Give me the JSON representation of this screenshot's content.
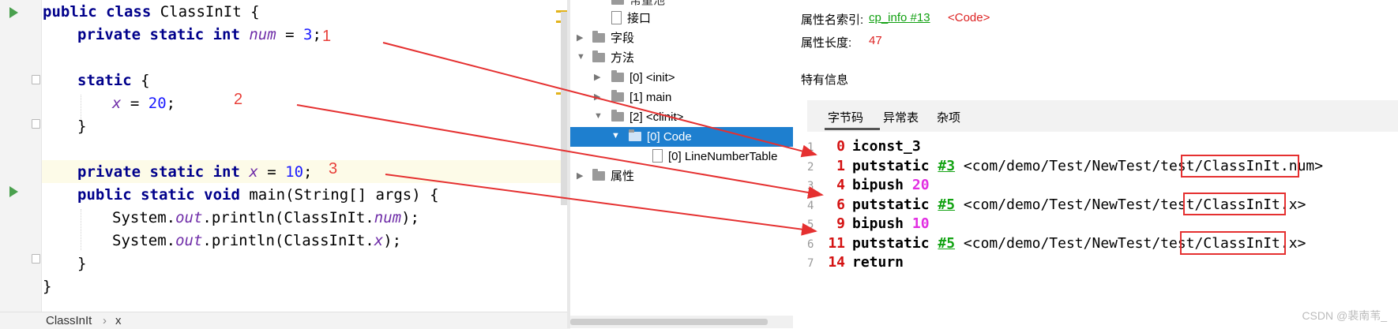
{
  "editor": {
    "lines": [
      {
        "kind": "class",
        "t1": "public class ",
        "t2": "ClassInIt {"
      },
      {
        "kind": "field",
        "k": "private static int ",
        "f": "num",
        "eq": " = ",
        "n": "3",
        "end": ";"
      },
      {
        "kind": "blank"
      },
      {
        "kind": "static",
        "k": "static",
        "rest": " {"
      },
      {
        "kind": "assign",
        "f": "x",
        "eq": " = ",
        "n": "20",
        "end": ";"
      },
      {
        "kind": "close",
        "t": "}"
      },
      {
        "kind": "blank"
      },
      {
        "kind": "field2",
        "k": "private static int ",
        "f": "x",
        "eq": " = ",
        "n": "10",
        "end": ";"
      },
      {
        "kind": "main",
        "k": "public static void ",
        "rest": "main(String[] args) {"
      },
      {
        "kind": "print",
        "a": "System.",
        "f": "out",
        "b": ".println(ClassInIt.",
        "f2": "num",
        "c": ");"
      },
      {
        "kind": "print",
        "a": "System.",
        "f": "out",
        "b": ".println(ClassInIt.",
        "f2": "x",
        "c": ");"
      },
      {
        "kind": "close",
        "t": "}"
      },
      {
        "kind": "close",
        "t": "}"
      }
    ],
    "annotations": [
      "1",
      "2",
      "3"
    ],
    "breadcrumb": {
      "class": "ClassInIt",
      "sep": "›",
      "member": "x"
    }
  },
  "tree": {
    "cut_item": "常量池",
    "items": [
      {
        "label": "接口"
      },
      {
        "label": "字段"
      },
      {
        "label": "方法"
      },
      {
        "label": "[0] <init>"
      },
      {
        "label": "[1] main"
      },
      {
        "label": "[2] <clinit>"
      },
      {
        "label": "[0] Code"
      },
      {
        "label": "[0] LineNumberTable"
      },
      {
        "label": "属性"
      }
    ]
  },
  "details": {
    "name_index_label": "属性名索引:",
    "name_index_link": "cp_info #13",
    "name_index_value": "<Code>",
    "length_label": "属性长度:",
    "length_value": "47",
    "specific_label": "特有信息",
    "tabs": [
      "字节码",
      "异常表",
      "杂项"
    ],
    "bytecode": [
      {
        "line": "1",
        "off": "0",
        "op": "iconst_3"
      },
      {
        "line": "2",
        "off": "1",
        "op": "putstatic",
        "ref": "#3",
        "desc_a": "<com/demo/Test/NewTest/test/",
        "desc_b": "ClassInIt.num>"
      },
      {
        "line": "3",
        "off": "4",
        "op": "bipush",
        "val": "20"
      },
      {
        "line": "4",
        "off": "6",
        "op": "putstatic",
        "ref": "#5",
        "desc_a": "<com/demo/Test/NewTest/test/",
        "desc_b": "ClassInIt.x>"
      },
      {
        "line": "5",
        "off": "9",
        "op": "bipush",
        "val": "10"
      },
      {
        "line": "6",
        "off": "11",
        "op": "putstatic",
        "ref": "#5",
        "desc_a": "<com/demo/Test/NewTest/test/",
        "desc_b": "ClassInIt.x>"
      },
      {
        "line": "7",
        "off": "14",
        "op": "return"
      }
    ]
  },
  "watermark": "CSDN @裴南苇_",
  "colors": {
    "annotation_red": "#e53030",
    "selection_blue": "#1e7fcf",
    "keyword": "#00008b",
    "field": "#6f2da8"
  }
}
